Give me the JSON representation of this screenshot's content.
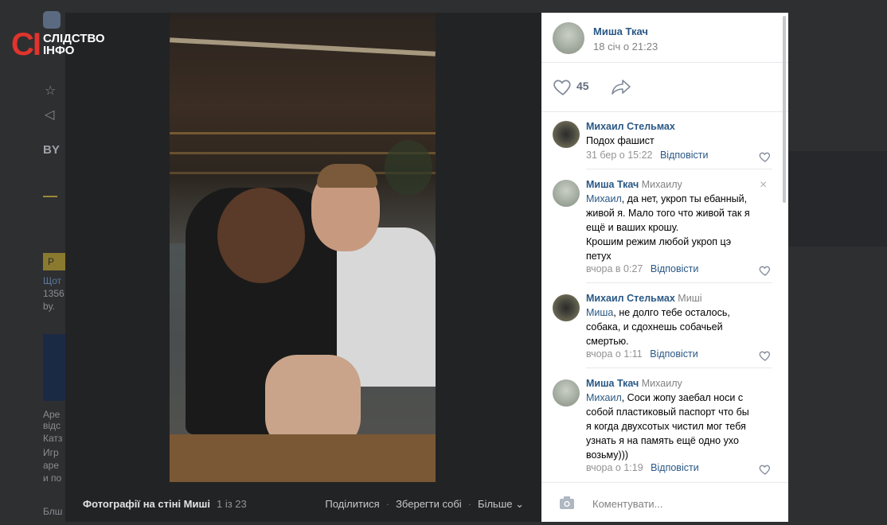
{
  "watermark": {
    "ci": "СІ",
    "text_line1": "СЛІДСТВО",
    "text_line2": "ІНФО"
  },
  "background": {
    "left_texts": [
      "BY",
      "Р",
      "Щот",
      "1356",
      "by.",
      "Аре",
      "відс",
      "Катз",
      "Игр",
      "аре",
      "и по",
      "Блш"
    ]
  },
  "viewer": {
    "album_title": "Фотографії на стіні Миші",
    "counter": "1 із 23",
    "actions": {
      "share": "Поділитися",
      "save": "Зберегти собі",
      "more": "Більше ⌄",
      "sep": "·"
    }
  },
  "post": {
    "author": "Миша Ткач",
    "date": "18 січ о 21:23",
    "likes": "45"
  },
  "comments": [
    {
      "author": "Михаил Стельмах",
      "reply_to": "",
      "lines": [
        "Подох фашист"
      ],
      "mention": "",
      "time": "31 бер о 15:22",
      "reply_label": "Відповісти"
    },
    {
      "author": "Миша Ткач",
      "reply_to": "Михаилу",
      "mention": "Михаил",
      "first_rest": ", да нет, укроп ты ебанный,",
      "lines": [
        "живой я. Мало того что живой так я",
        "ещё и ваших крошу.",
        "Крошим режим любой укроп цэ",
        "петух"
      ],
      "time": "вчора в 0:27",
      "reply_label": "Відповісти",
      "close": "×"
    },
    {
      "author": "Михаил Стельмах",
      "reply_to": "Миші",
      "mention": "Миша",
      "first_rest": ", не долго тебе осталось,",
      "lines": [
        "собака, и сдохнешь собачьей",
        "смертью."
      ],
      "time": "вчора о 1:11",
      "reply_label": "Відповісти"
    },
    {
      "author": "Миша Ткач",
      "reply_to": "Михаилу",
      "mention": "Михаил",
      "first_rest": ", Соси жопу заебал носи с",
      "lines": [
        "собой пластиковый паспорт что бы",
        "я когда двухсотых чистил мог тебя",
        "узнать я на память ещё одно ухо",
        "возьму)))"
      ],
      "time": "вчора о 1:19",
      "reply_label": "Відповісти"
    }
  ],
  "composer": {
    "placeholder": "Коментувати..."
  },
  "icons": [
    "heart-icon",
    "share-arrow-icon",
    "camera-icon",
    "close-icon",
    "vk-logo-icon",
    "star-icon",
    "megaphone-icon"
  ],
  "colors": {
    "link": "#2a5885",
    "meta": "#939393",
    "overlay": "#2e2f31",
    "viewer": "#222324",
    "brand_red": "#e0342c"
  }
}
